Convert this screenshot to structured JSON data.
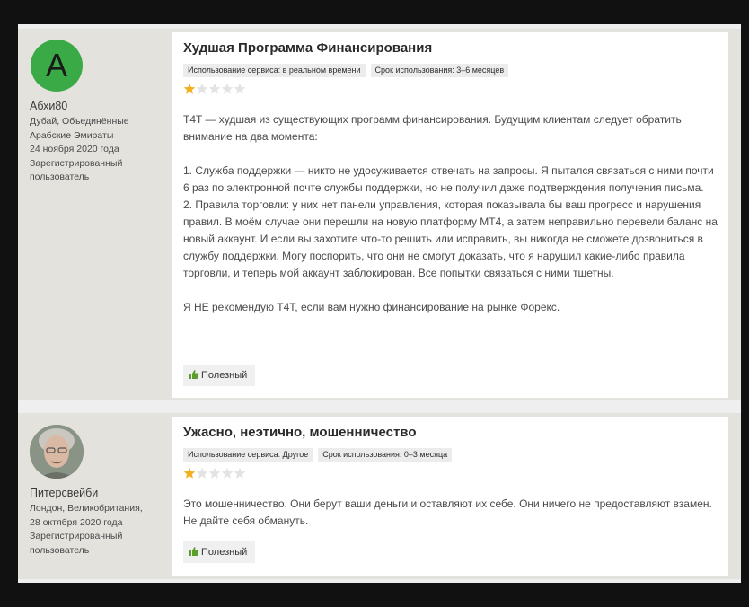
{
  "colors": {
    "page_bg": "#111111",
    "panel_bg": "#efefef",
    "sidebar_bg": "#e4e2dd",
    "card_bg": "#ffffff",
    "avatar_green": "#3aaa47",
    "star_filled": "#f2b01e",
    "star_empty": "#e3e3e3",
    "thumb_green": "#5a9e2c"
  },
  "reviews": [
    {
      "user": {
        "avatar_letter": "A",
        "name": "Абхи80",
        "location": "Дубай, Объединённые Арабские Эмираты",
        "date": "24 ноября 2020 года",
        "status": "Зарегистрированный пользователь"
      },
      "title": "Худшая Программа Финансирования",
      "tags": [
        "Использование сервиса: в реальном времени",
        "Срок использования: 3–6 месяцев"
      ],
      "rating": 1,
      "rating_max": 5,
      "paragraphs": [
        "T4T — худшая из существующих программ финансирования. Будущим клиентам следует обратить внимание на два момента:",
        "",
        "1. Служба поддержки — никто не удосуживается отвечать на запросы. Я пытался связаться с ними почти 6 раз по электронной почте службы поддержки, но не получил даже подтверждения получения письма.",
        "2. Правила торговли: у них нет панели управления, которая показывала бы ваш прогресс и нарушения правил. В моём случае они перешли на новую платформу MT4, а затем неправильно перевели баланс на новый аккаунт. И если вы захотите что-то решить или исправить, вы никогда не сможете дозвониться в службу поддержки. Могу поспорить, что они не смогут доказать, что я нарушил какие-либо правила торговли, и теперь мой аккаунт заблокирован. Все попытки связаться с ними тщетны.",
        "",
        "Я НЕ рекомендую T4T, если вам нужно финансирование на рынке Форекс."
      ],
      "helpful_label": "Полезный"
    },
    {
      "user": {
        "avatar_letter": "",
        "name": "Питерсвейби",
        "location": "Лондон, Великобритания,",
        "date": "28 октября 2020 года",
        "status": "Зарегистрированный пользователь"
      },
      "title": "Ужасно, неэтично, мошенничество",
      "tags": [
        "Использование сервиса: Другое",
        "Срок использования: 0–3 месяца"
      ],
      "rating": 1,
      "rating_max": 5,
      "paragraphs": [
        "Это мошенничество. Они берут ваши деньги и оставляют их себе. Они ничего не предоставляют взамен. Не дайте себя обмануть."
      ],
      "helpful_label": "Полезный"
    }
  ]
}
